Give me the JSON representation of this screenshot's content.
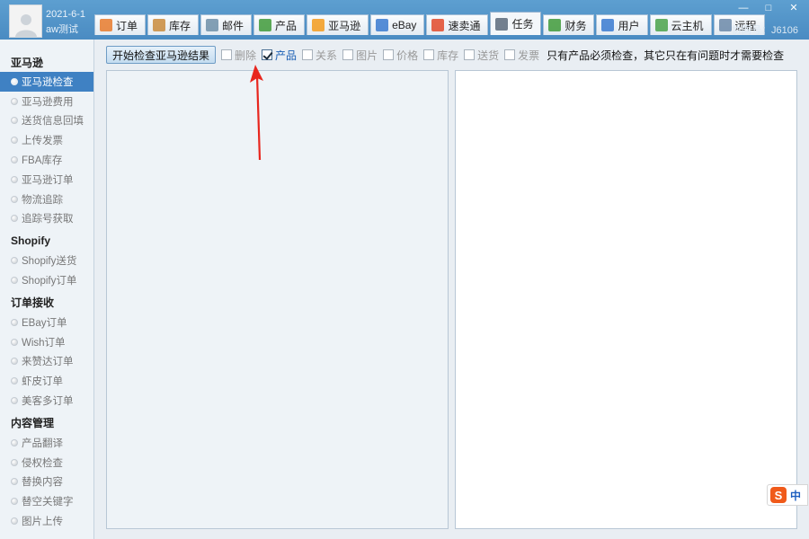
{
  "user": {
    "date": "2021-6-1",
    "name": "aw测试"
  },
  "tabs": [
    {
      "label": "订单",
      "icon": "order-icon",
      "color": "#e87a2c"
    },
    {
      "label": "库存",
      "icon": "inventory-box-icon",
      "color": "#c98b3c"
    },
    {
      "label": "邮件",
      "icon": "mail-icon",
      "color": "#6f8fa8"
    },
    {
      "label": "产品",
      "icon": "product-grid-icon",
      "color": "#3f9a3a"
    },
    {
      "label": "亚马逊",
      "icon": "amazon-icon",
      "color": "#f39b1c"
    },
    {
      "label": "eBay",
      "icon": "ebay-bag-icon",
      "color": "#3a7ad0"
    },
    {
      "label": "速卖通",
      "icon": "aliexpress-icon",
      "color": "#e24a2a"
    },
    {
      "label": "任务",
      "icon": "task-icon",
      "color": "#5a6a7a"
    },
    {
      "label": "财务",
      "icon": "money-icon",
      "color": "#3f9a3a"
    },
    {
      "label": "用户",
      "icon": "user-icon",
      "color": "#3a7ad0"
    },
    {
      "label": "云主机",
      "icon": "cloud-globe-icon",
      "color": "#4aa24a"
    },
    {
      "label": "远程",
      "icon": "remote-monitor-icon",
      "color": "#6b88a8"
    }
  ],
  "active_tab_index": 7,
  "window": {
    "minimize": "—",
    "maximize": "□",
    "close": "✕",
    "assist_label": "协同号：J6106"
  },
  "sidebar": {
    "sections": [
      {
        "title": "亚马逊",
        "items": [
          "亚马逊检查",
          "亚马逊费用",
          "送货信息回填",
          "上传发票",
          "FBA库存",
          "亚马逊订单",
          "物流追踪",
          "追踪号获取"
        ]
      },
      {
        "title": "Shopify",
        "items": [
          "Shopify送货",
          "Shopify订单"
        ]
      },
      {
        "title": "订单接收",
        "items": [
          "EBay订单",
          "Wish订单",
          "来赞达订单",
          "虾皮订单",
          "美客多订单"
        ]
      },
      {
        "title": "内容管理",
        "items": [
          "产品翻译",
          "侵权检查",
          "替换内容",
          "替空关键字",
          "图片上传"
        ]
      }
    ],
    "active_item": "亚马逊检查"
  },
  "toolbar": {
    "start_button": "开始检查亚马逊结果",
    "options": [
      {
        "label": "删除",
        "checked": false
      },
      {
        "label": "产品",
        "checked": true
      },
      {
        "label": "关系",
        "checked": false
      },
      {
        "label": "图片",
        "checked": false
      },
      {
        "label": "价格",
        "checked": false
      },
      {
        "label": "库存",
        "checked": false
      },
      {
        "label": "送货",
        "checked": false
      },
      {
        "label": "发票",
        "checked": false
      }
    ],
    "note": "只有产品必须检查，其它只在有问题时才需要检查"
  },
  "ime": {
    "logo": "S",
    "lang": "中"
  },
  "colors": {
    "accent": "#3f81c3",
    "annotation_arrow": "#e8261e"
  }
}
